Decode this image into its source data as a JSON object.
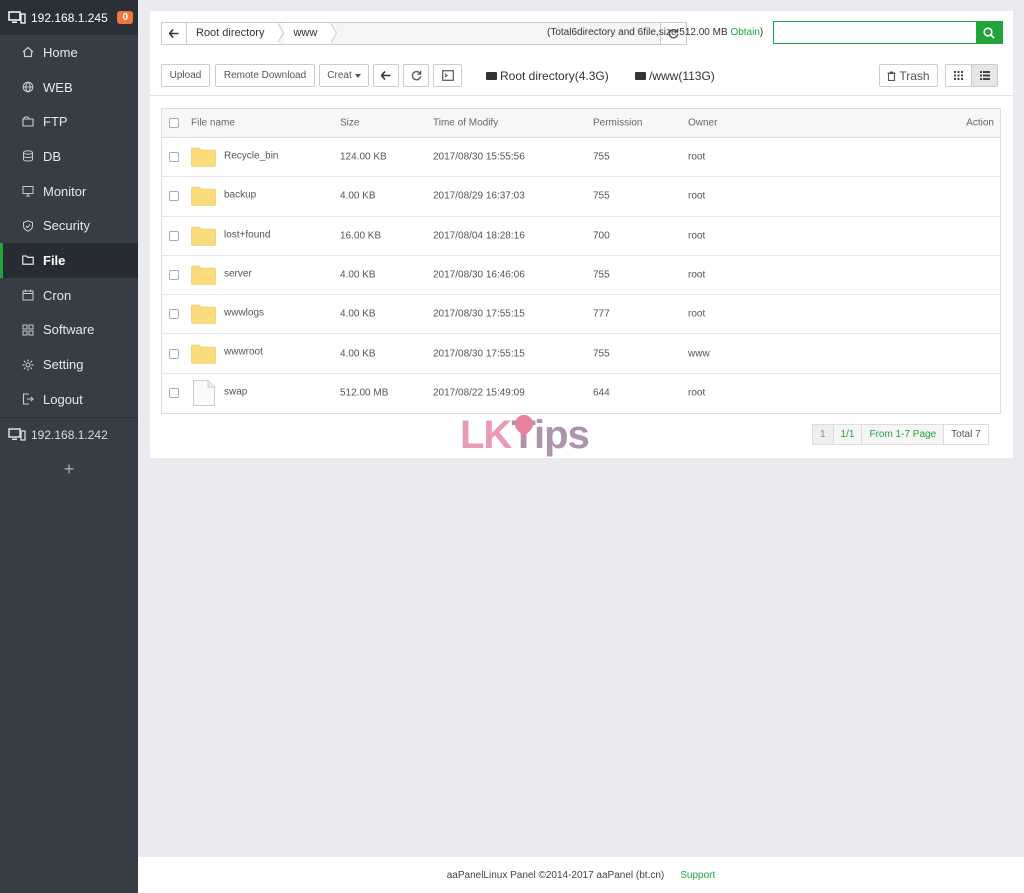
{
  "sidebar": {
    "host": "192.168.1.245",
    "badge": "0",
    "items": [
      {
        "label": "Home",
        "icon": "home-icon"
      },
      {
        "label": "WEB",
        "icon": "globe-icon"
      },
      {
        "label": "FTP",
        "icon": "ftp-icon"
      },
      {
        "label": "DB",
        "icon": "database-icon"
      },
      {
        "label": "Monitor",
        "icon": "monitor-icon"
      },
      {
        "label": "Security",
        "icon": "shield-icon"
      },
      {
        "label": "File",
        "icon": "folder-icon"
      },
      {
        "label": "Cron",
        "icon": "calendar-icon"
      },
      {
        "label": "Software",
        "icon": "grid-icon"
      },
      {
        "label": "Setting",
        "icon": "gear-icon"
      },
      {
        "label": "Logout",
        "icon": "logout-icon"
      }
    ],
    "active": "File",
    "host2": "192.168.1.242",
    "add": "+"
  },
  "path": {
    "crumbs": [
      "Root directory",
      "www"
    ]
  },
  "summary": {
    "text": "(Total6directory and 6file,size:512.00 MB",
    "obtain": "Obtain",
    "close": ")"
  },
  "search": {
    "placeholder": ""
  },
  "toolbar": {
    "upload": "Upload",
    "remote_download": "Remote Download",
    "creat": "Creat",
    "root_disk": "Root directory(4.3G)",
    "www_disk": "/www(113G)",
    "trash": "Trash"
  },
  "table": {
    "headers": {
      "name": "File name",
      "size": "Size",
      "time": "Time of Modify",
      "perm": "Permission",
      "owner": "Owner",
      "action": "Action"
    },
    "rows": [
      {
        "name": "Recycle_bin",
        "size": "124.00 KB",
        "time": "2017/08/30 15:55:56",
        "perm": "755",
        "owner": "root",
        "type": "folder"
      },
      {
        "name": "backup",
        "size": "4.00 KB",
        "time": "2017/08/29 16:37:03",
        "perm": "755",
        "owner": "root",
        "type": "folder"
      },
      {
        "name": "lost+found",
        "size": "16.00 KB",
        "time": "2017/08/04 18:28:16",
        "perm": "700",
        "owner": "root",
        "type": "folder"
      },
      {
        "name": "server",
        "size": "4.00 KB",
        "time": "2017/08/30 16:46:06",
        "perm": "755",
        "owner": "root",
        "type": "folder"
      },
      {
        "name": "wwwlogs",
        "size": "4.00 KB",
        "time": "2017/08/30 17:55:15",
        "perm": "777",
        "owner": "root",
        "type": "folder"
      },
      {
        "name": "wwwroot",
        "size": "4.00 KB",
        "time": "2017/08/30 17:55:15",
        "perm": "755",
        "owner": "www",
        "type": "folder"
      },
      {
        "name": "swap",
        "size": "512.00 MB",
        "time": "2017/08/22 15:49:09",
        "perm": "644",
        "owner": "root",
        "type": "file"
      }
    ]
  },
  "pager": {
    "current": "1",
    "pages": "1/1",
    "range": "From 1-7 Page",
    "total": "Total 7"
  },
  "watermark": {
    "lk": "LK",
    "tips": "Tips"
  },
  "footer": {
    "copyright": "aaPanelLinux Panel ©2014-2017 aaPanel (bt.cn)",
    "support": "Support"
  },
  "colors": {
    "accent": "#20a53a",
    "sidebar": "#363d45",
    "badge": "#f0763a"
  }
}
